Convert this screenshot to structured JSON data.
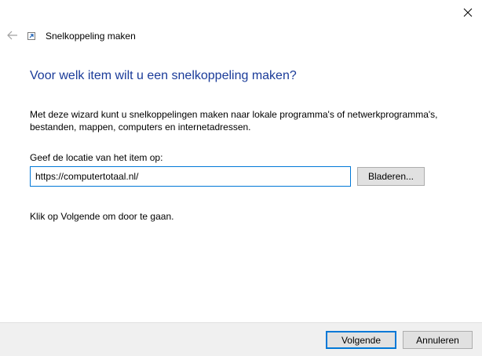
{
  "window": {
    "title": "Snelkoppeling maken",
    "icons": {
      "close": "close-icon",
      "back": "back-arrow-icon",
      "app": "shortcut-icon"
    }
  },
  "wizard": {
    "heading": "Voor welk item wilt u een snelkoppeling maken?",
    "description": "Met deze wizard kunt u snelkoppelingen maken naar lokale programma's of netwerkprogramma's, bestanden, mappen, computers en internetadressen.",
    "location_label": "Geef de locatie van het item op:",
    "location_value": "https://computertotaal.nl/",
    "browse_label": "Bladeren...",
    "hint": "Klik op Volgende om door te gaan."
  },
  "footer": {
    "next_label": "Volgende",
    "cancel_label": "Annuleren"
  },
  "colors": {
    "heading": "#1a3b99",
    "accent": "#0078d7",
    "footer_bg": "#f0f0f0"
  }
}
